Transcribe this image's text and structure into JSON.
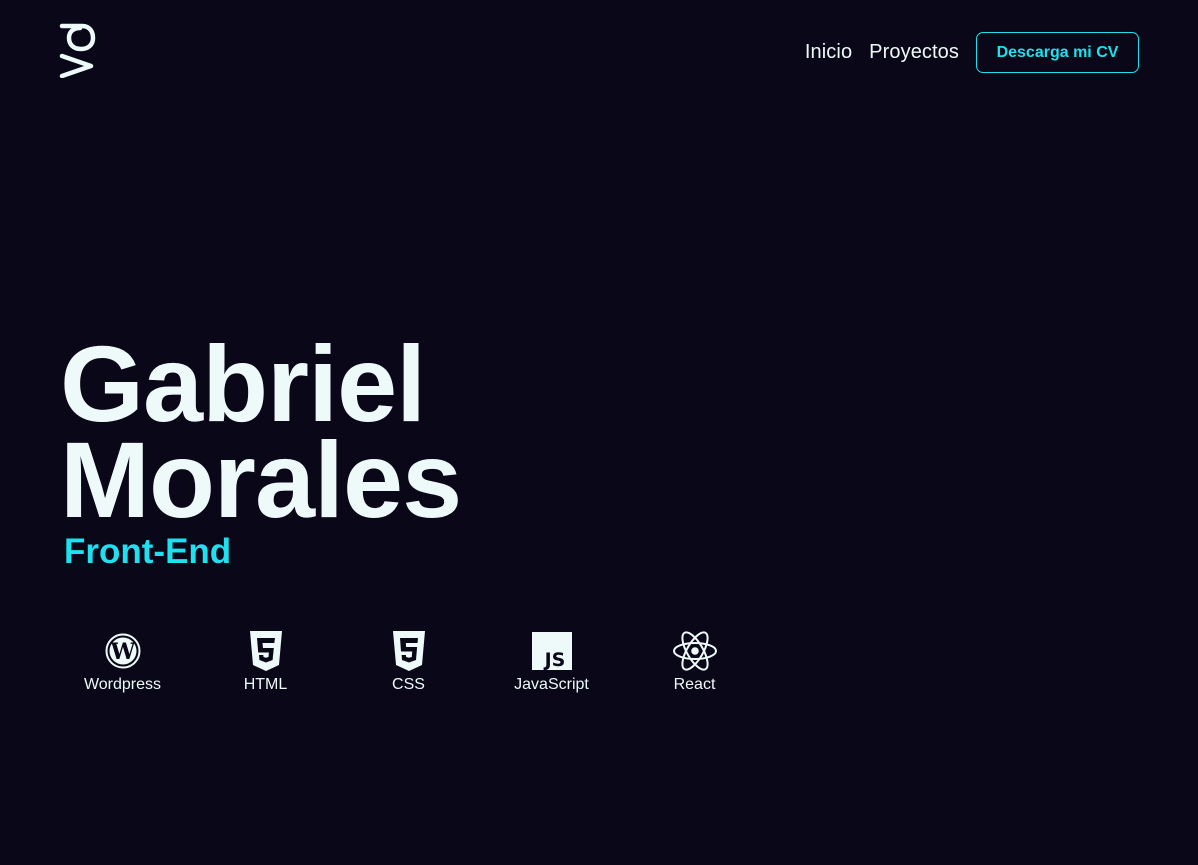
{
  "header": {
    "logo_icon": "va-logo-icon",
    "nav": [
      {
        "label": "Inicio"
      },
      {
        "label": "Proyectos"
      }
    ],
    "cv_button_label": "Descarga mi CV"
  },
  "hero": {
    "first_name": "Gabriel",
    "last_name": "Morales",
    "role": "Front-End"
  },
  "skills": [
    {
      "label": "Wordpress",
      "icon": "wordpress-icon"
    },
    {
      "label": "HTML",
      "icon": "html5-icon"
    },
    {
      "label": "CSS",
      "icon": "css3-icon"
    },
    {
      "label": "JavaScript",
      "icon": "javascript-icon"
    },
    {
      "label": "React",
      "icon": "react-icon"
    }
  ],
  "colors": {
    "background": "#0a0818",
    "text": "#eefafa",
    "accent": "#1ee0ee"
  }
}
